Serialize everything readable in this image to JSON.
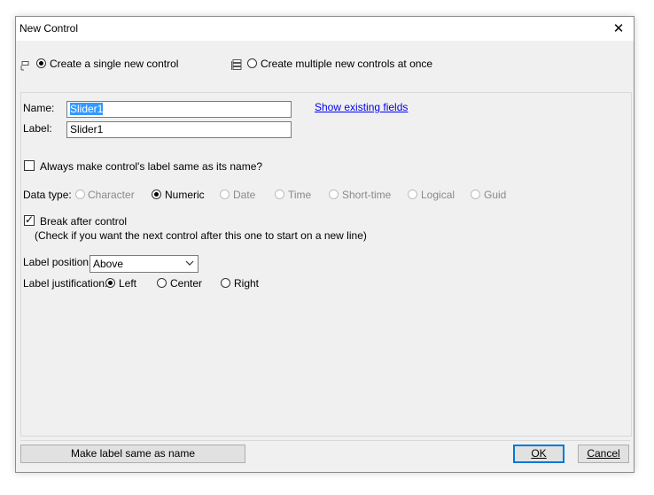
{
  "window": {
    "title": "New Control",
    "close_glyph": "✕"
  },
  "mode": {
    "single_label": "Create a single new control",
    "multiple_label": "Create multiple new controls at once",
    "selected": "single"
  },
  "form": {
    "name_label": "Name:",
    "name_value": "Slider1",
    "label_label": "Label:",
    "label_value": "Slider1",
    "show_fields_link": "Show existing fields",
    "always_same_label": "Always make control's label same as its name?",
    "data_type_label": "Data type:",
    "data_types": [
      "Character",
      "Numeric",
      "Date",
      "Time",
      "Short-time",
      "Logical",
      "Guid"
    ],
    "data_type_selected": "Numeric",
    "break_after_label": "Break after control",
    "break_after_hint": "(Check if you want the next control after this one to start on a new line)",
    "label_position_label": "Label position:",
    "label_position_value": "Above",
    "label_just_label": "Label justification:",
    "justifications": [
      "Left",
      "Center",
      "Right"
    ],
    "justification_selected": "Left"
  },
  "buttons": {
    "make_same": "Make label same as name",
    "ok": "OK",
    "cancel": "Cancel"
  }
}
